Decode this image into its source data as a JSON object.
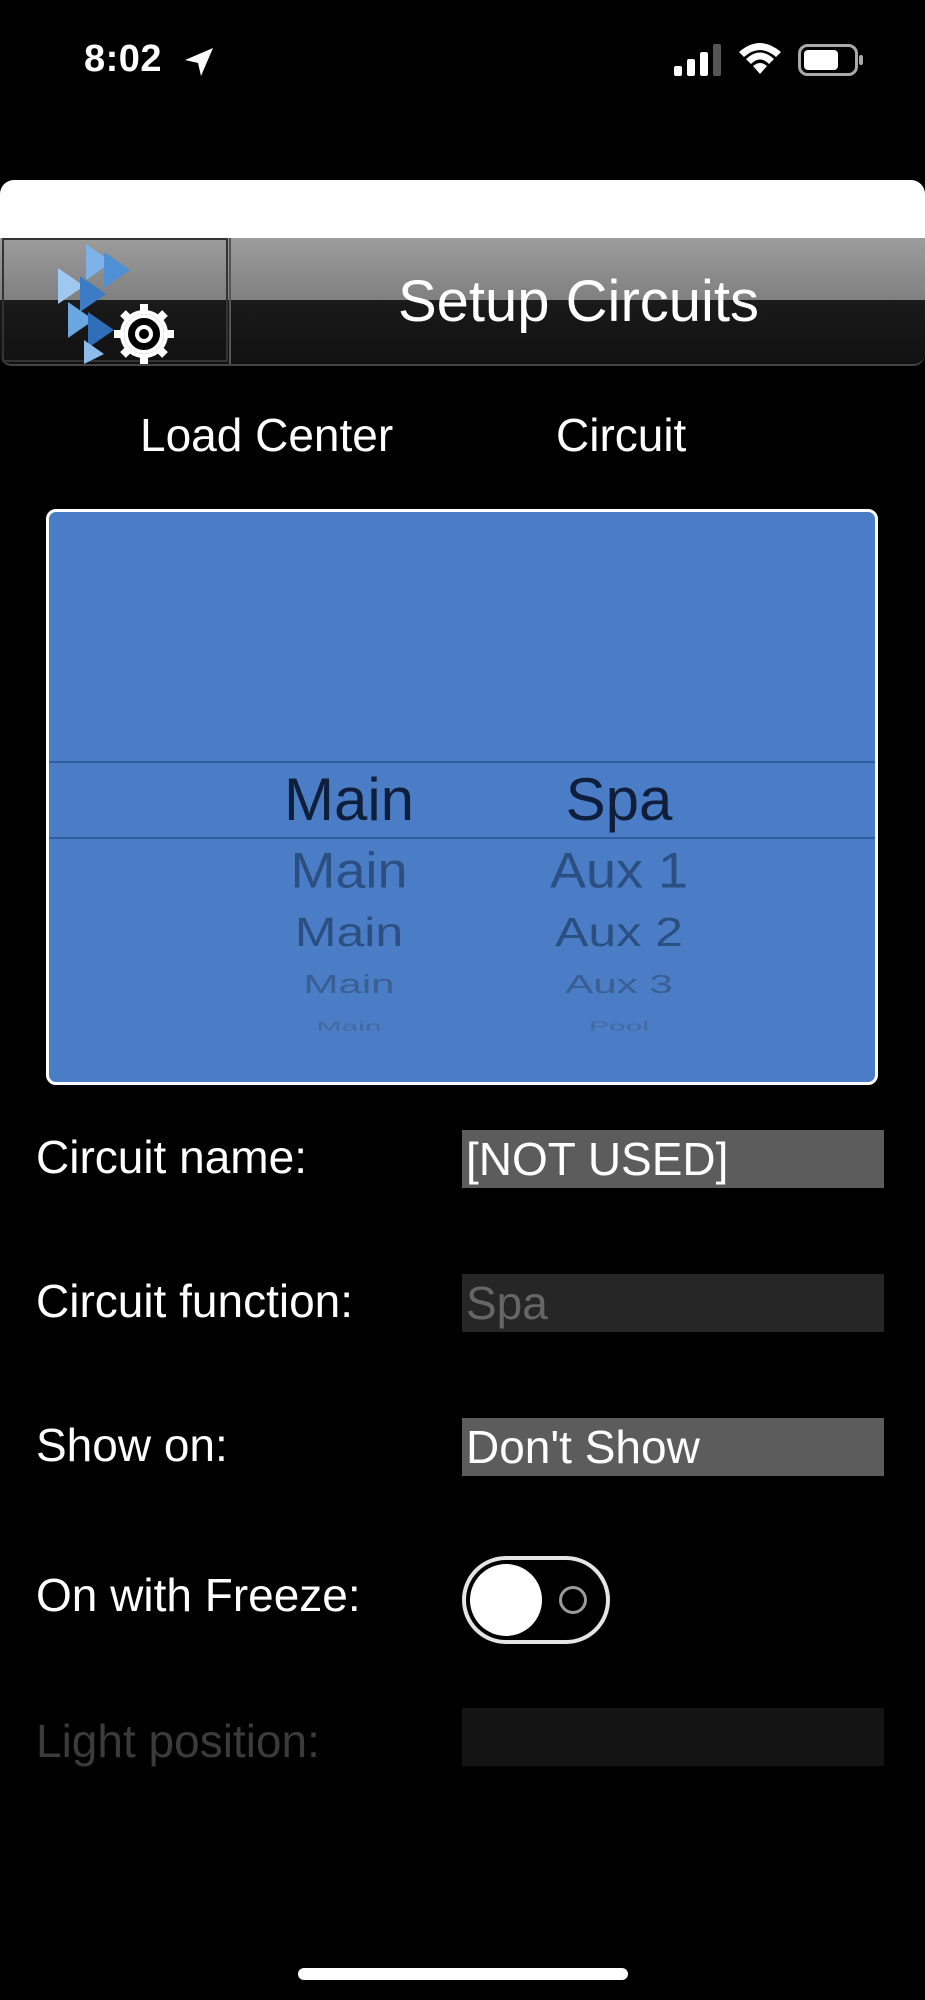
{
  "status": {
    "time": "8:02"
  },
  "nav": {
    "title": "Setup Circuits"
  },
  "picker": {
    "headers": {
      "load_center": "Load Center",
      "circuit": "Circuit"
    },
    "rows": [
      {
        "load": "Main",
        "circuit": "Spa"
      },
      {
        "load": "Main",
        "circuit": "Aux 1"
      },
      {
        "load": "Main",
        "circuit": "Aux 2"
      },
      {
        "load": "Main",
        "circuit": "Aux 3"
      },
      {
        "load": "Main",
        "circuit": "Pool"
      }
    ],
    "colors": {
      "background": "#4a7dc6"
    }
  },
  "form": {
    "circuit_name": {
      "label": "Circuit name:",
      "value": "[NOT USED]"
    },
    "circuit_function": {
      "label": "Circuit function:",
      "value": "Spa"
    },
    "show_on": {
      "label": "Show on:",
      "value": "Don't Show"
    },
    "on_with_freeze": {
      "label": "On with Freeze:",
      "on": false
    },
    "light_position": {
      "label": "Light position:",
      "value": ""
    }
  }
}
